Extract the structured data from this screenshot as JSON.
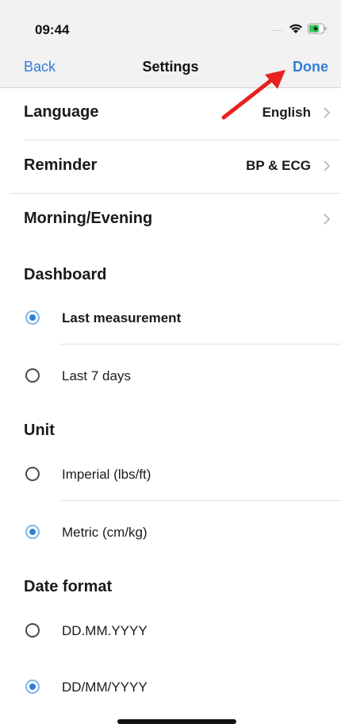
{
  "status_bar": {
    "time": "09:44",
    "icons": [
      "signal-dots-icon",
      "wifi-icon",
      "battery-charging-icon"
    ]
  },
  "nav": {
    "back": "Back",
    "title": "Settings",
    "done": "Done"
  },
  "settings_rows": [
    {
      "label": "Language",
      "value": "English"
    },
    {
      "label": "Reminder",
      "value": "BP & ECG"
    },
    {
      "label": "Morning/Evening",
      "value": ""
    }
  ],
  "dashboard": {
    "title": "Dashboard",
    "options": [
      {
        "label": "Last measurement",
        "selected": true
      },
      {
        "label": "Last 7 days",
        "selected": false
      }
    ]
  },
  "unit": {
    "title": "Unit",
    "options": [
      {
        "label": "Imperial (lbs/ft)",
        "selected": false
      },
      {
        "label": "Metric (cm/kg)",
        "selected": true
      }
    ]
  },
  "date_format": {
    "title": "Date format",
    "options": [
      {
        "label": "DD.MM.YYYY",
        "selected": false
      },
      {
        "label": "DD/MM/YYYY",
        "selected": true
      }
    ]
  },
  "colors": {
    "accent": "#2f7fd6",
    "annotation_arrow": "#e8201e"
  }
}
